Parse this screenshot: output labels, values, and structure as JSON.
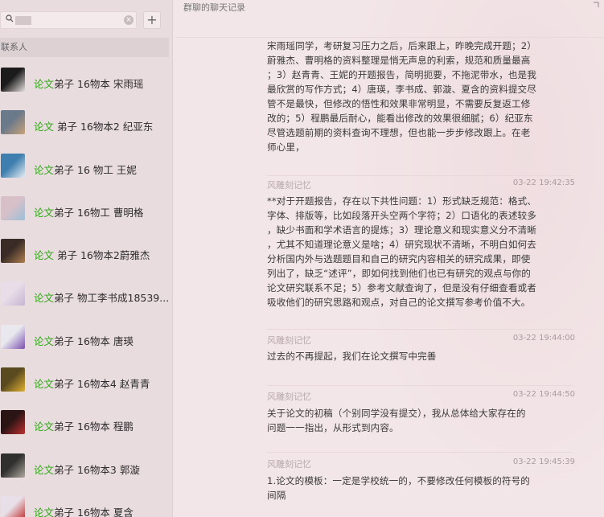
{
  "search": {
    "value": "",
    "placeholder": ""
  },
  "sidebar": {
    "section_label": "联系人",
    "contacts": [
      {
        "tag": "论文",
        "name": "弟子 16物本 宋雨瑶"
      },
      {
        "tag": "论文",
        "name": " 弟子 16物本2 纪亚东"
      },
      {
        "tag": "论文",
        "name": "弟子 16 物工 王妮"
      },
      {
        "tag": "论文",
        "name": "弟子 16物工 曹明格"
      },
      {
        "tag": "论文",
        "name": " 弟子 16物本2蔚雅杰"
      },
      {
        "tag": "论文",
        "name": "弟子 物工李书成18539..."
      },
      {
        "tag": "论文",
        "name": "弟子 16物本 唐瑛"
      },
      {
        "tag": "论文",
        "name": "弟子 16物本4 赵青青"
      },
      {
        "tag": "论文",
        "name": "弟子 16物本 程鹏"
      },
      {
        "tag": "论文",
        "name": "弟子 16物本3 郭漩"
      },
      {
        "tag": "论文",
        "name": "弟子 16物本 夏含"
      }
    ]
  },
  "chat": {
    "title": "群聊的聊天记录",
    "messages": [
      {
        "sender": "",
        "time": "",
        "lines": [
          "宋雨瑶同学，考研复习压力之后，后来跟上，昨晚完成开题；2）",
          "蔚雅杰、曹明格的资料整理是悄无声息的利索，规范和质量最高",
          "；3）赵青青、王妮的开题报告，简明扼要，不拖泥带水，也是我",
          "最欣赏的写作方式；4）唐瑛，李书成、郭漩、夏含的资料提交尽",
          "管不是最快，但修改的悟性和效果非常明显，不需要反复返工修",
          "改的；5）程鹏最后耐心，能看出修改的效果很细腻；6）纪亚东",
          "尽管选题前期的资料查询不理想，但也能一步步修改跟上。在老",
          "师心里，"
        ]
      },
      {
        "sender": "风雕刻记忆",
        "time": "03-22 19:42:35",
        "lines": [
          "**对于开题报告，存在以下共性问题：1）形式缺乏规范：格式、",
          "字体、排版等，比如段落开头空两个字符；2）口语化的表述较多",
          "，缺少书面和学术语言的提炼；3）理论意义和现实意义分不清晰",
          "，尤其不知道理论意义是啥；4）研究现状不清晰，不明白如何去",
          "分析国内外与选题题目和自己的研究内容相关的研究成果，即使",
          "列出了，缺乏“述评”，即如何找到他们也已有研究的观点与你的",
          "论文研究联系不足；5）参考文献查询了，但是没有仔细查看或者",
          "吸收他们的研究思路和观点，对自己的论文撰写参考价值不大。"
        ]
      },
      {
        "sender": "风雕刻记忆",
        "time": "03-22 19:44:00",
        "lines": [
          "过去的不再提起，我们在论文撰写中完善"
        ]
      },
      {
        "sender": "风雕刻记忆",
        "time": "03-22 19:44:50",
        "lines": [
          "关于论文的初稿（个别同学没有提交），我从总体给大家存在的",
          "问题一一指出，从形式到内容。"
        ]
      },
      {
        "sender": "风雕刻记忆",
        "time": "03-22 19:45:39",
        "lines": [
          "1.论文的模板：一定是学校统一的，不要修改任何模板的符号的",
          "间隔"
        ]
      }
    ]
  },
  "colors": {
    "tag": "#29a80f",
    "background": "#f3e6e8",
    "sidebar": "#e9dcdf"
  },
  "icons": {
    "search": "search-icon",
    "clear": "clear-icon",
    "add": "add-icon",
    "corner": "pin-icon"
  }
}
